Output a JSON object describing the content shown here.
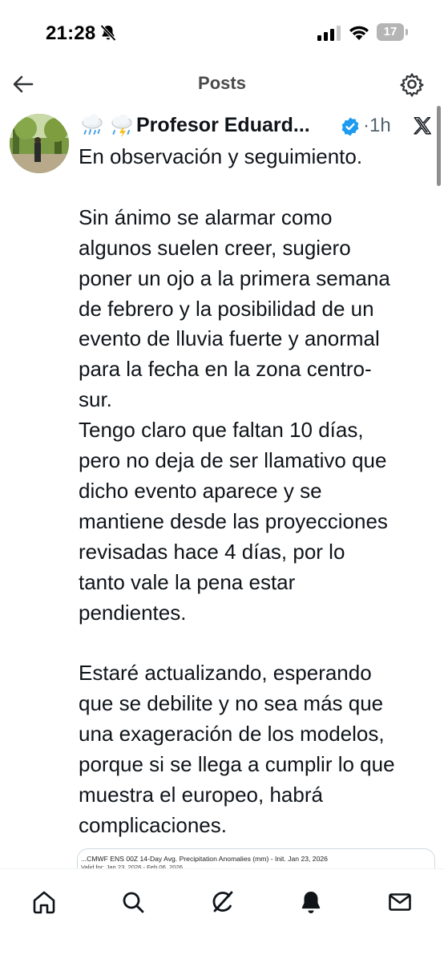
{
  "status_bar": {
    "time": "21:28",
    "battery_level": "17"
  },
  "header": {
    "title": "Posts"
  },
  "post": {
    "author_name": "Profesor Eduard...",
    "time": "·1h",
    "paragraphs": [
      [
        "En observación y seguimiento."
      ],
      [
        "Sin ánimo se alarmar como",
        "algunos suelen creer, sugiero",
        "poner un ojo a la primera semana",
        "de febrero y la posibilidad de un",
        "evento de lluvia fuerte y anormal",
        "para la fecha en la zona centro-",
        "sur.",
        "Tengo claro que faltan 10 días,",
        "pero no deja de ser llamativo que",
        "dicho evento aparece y se",
        "mantiene desde las proyecciones",
        "revisadas hace 4 días, por lo",
        "tanto vale la pena estar",
        "pendientes."
      ],
      [
        "Estaré actualizando, esperando",
        "que se debilite y no sea más que",
        "una exageración de los modelos,",
        "porque si se llega a cumplir lo que",
        "muestra el europeo, habrá",
        "complicaciones."
      ]
    ],
    "media": {
      "title": "...CMWF ENS 00Z 14-Day Avg. Precipitation Anomalies (mm) - Init. Jan 23, 2026",
      "valid": "Valid for: Jan 23, 2026 - Feb 06, 2026"
    }
  },
  "bottom_nav": {
    "items": [
      "home",
      "search",
      "grok",
      "notifications",
      "messages"
    ]
  }
}
